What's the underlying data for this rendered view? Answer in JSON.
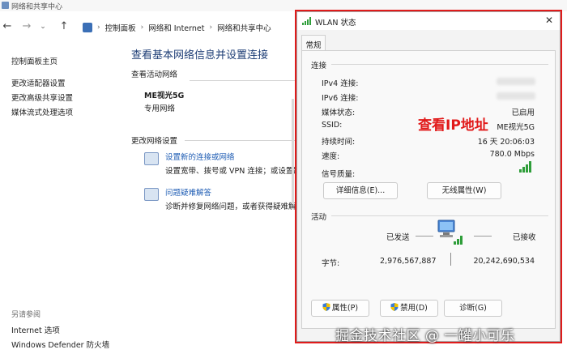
{
  "explorer": {
    "window_title": "网络和共享中心",
    "breadcrumb": [
      "控制面板",
      "网络和 Internet",
      "网络和共享中心"
    ],
    "sidebar": {
      "links": [
        "控制面板主页",
        "更改适配器设置",
        "更改高级共享设置",
        "媒体流式处理选项"
      ],
      "see_also_heading": "另请参阅",
      "see_also": [
        "Internet 选项",
        "Windows Defender 防火墙"
      ]
    },
    "main": {
      "title": "查看基本网络信息并设置连接",
      "active_networks_label": "查看活动网络",
      "network_name": "ME视光5G",
      "network_type": "专用网络",
      "change_settings_label": "更改网络设置",
      "tasks": [
        {
          "link": "设置新的连接或网络",
          "desc": "设置宽带、拨号或 VPN 连接；或设置路"
        },
        {
          "link": "问题疑难解答",
          "desc": "诊断并修复网络问题，或者获得疑难解"
        }
      ]
    }
  },
  "dialog": {
    "title": "WLAN 状态",
    "tab": "常规",
    "connection": {
      "label": "连接",
      "rows": [
        {
          "key": "IPv4 连接:",
          "value": ""
        },
        {
          "key": "IPv6 连接:",
          "value": ""
        },
        {
          "key": "媒体状态:",
          "value": "已启用"
        },
        {
          "key": "SSID:",
          "value": "ME视光5G"
        },
        {
          "key": "持续时间:",
          "value": "16 天 20:06:03"
        },
        {
          "key": "速度:",
          "value": "780.0 Mbps"
        }
      ],
      "signal_label": "信号质量:",
      "details_button": "详细信息(E)...",
      "wireless_props_button": "无线属性(W)"
    },
    "activity": {
      "label": "活动",
      "sent_label": "已发送",
      "received_label": "已接收",
      "bytes_label": "字节:",
      "bytes_sent": "2,976,567,887",
      "bytes_received": "20,242,690,534"
    },
    "buttons": {
      "properties": "属性(P)",
      "disable": "禁用(D)",
      "diagnose": "诊断(G)"
    }
  },
  "annotation": "查看IP地址",
  "watermark": "掘金技术社区 @ 一罐小可乐",
  "colors": {
    "annotation_red": "#e11919",
    "link_blue": "#1f5db4",
    "title_blue": "#1e3e76",
    "signal_green": "#2f9e3a"
  }
}
